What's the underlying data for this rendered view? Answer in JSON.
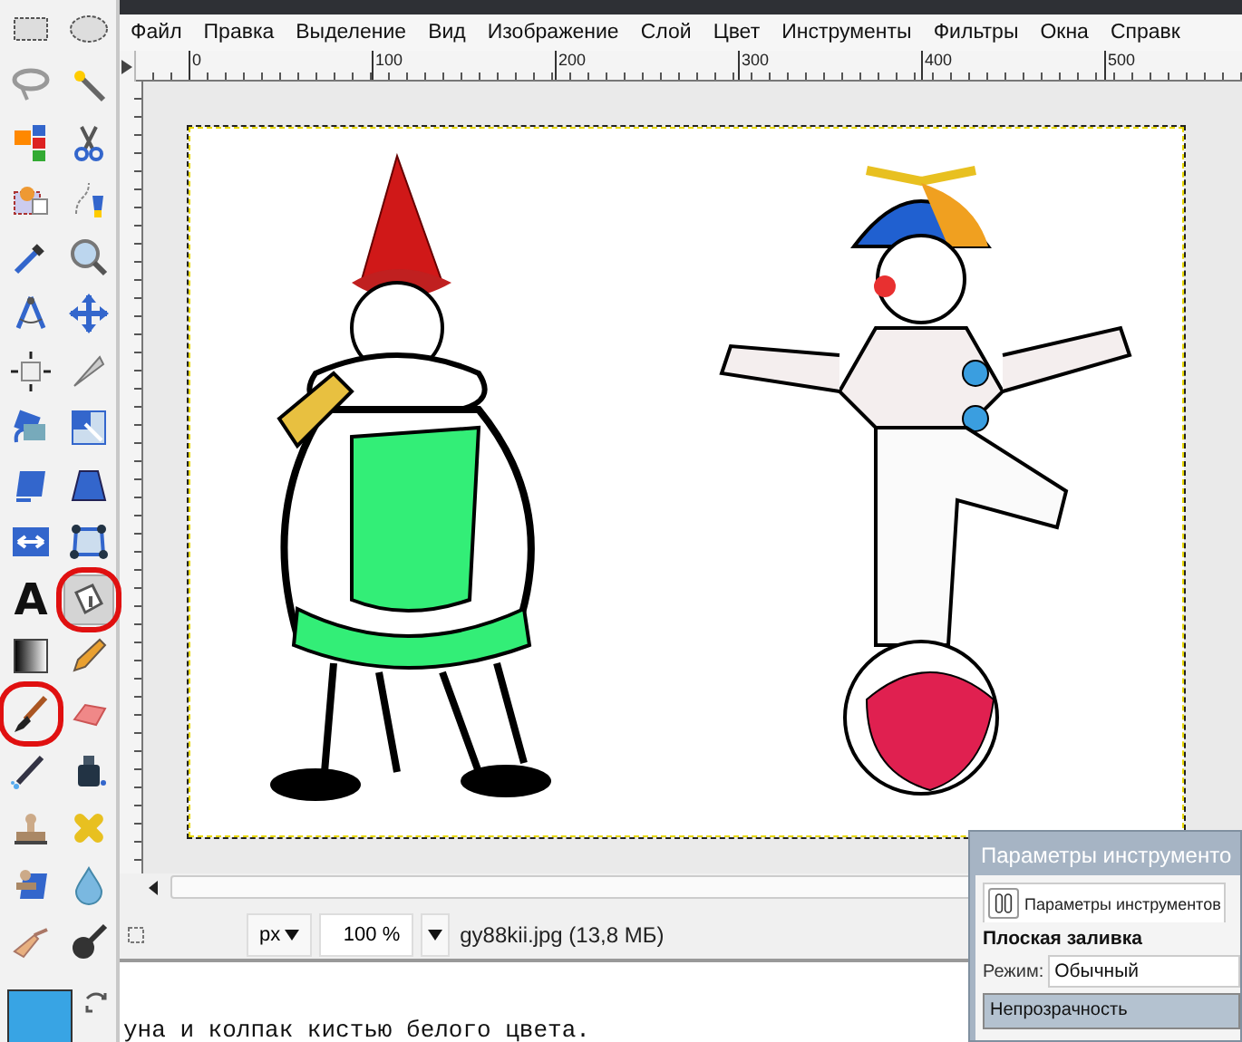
{
  "toolbox": {
    "tools": [
      {
        "selected": false,
        "circled": false
      },
      {
        "selected": false,
        "circled": false
      },
      {
        "selected": false,
        "circled": false
      },
      {
        "selected": false,
        "circled": false
      },
      {
        "selected": false,
        "circled": false
      },
      {
        "selected": false,
        "circled": false
      },
      {
        "selected": false,
        "circled": false
      },
      {
        "selected": false,
        "circled": false
      },
      {
        "selected": false,
        "circled": false
      },
      {
        "selected": false,
        "circled": false
      },
      {
        "selected": false,
        "circled": false
      },
      {
        "selected": false,
        "circled": false
      },
      {
        "selected": false,
        "circled": false
      },
      {
        "selected": false,
        "circled": false
      },
      {
        "selected": false,
        "circled": false
      },
      {
        "selected": false,
        "circled": false
      },
      {
        "selected": false,
        "circled": false
      },
      {
        "selected": false,
        "circled": false
      },
      {
        "selected": false,
        "circled": false
      },
      {
        "selected": false,
        "circled": false
      },
      {
        "selected": false,
        "circled": false,
        "glyph": "A"
      },
      {
        "selected": true,
        "circled": true
      },
      {
        "selected": false,
        "circled": false
      },
      {
        "selected": false,
        "circled": false
      },
      {
        "selected": false,
        "circled": true
      },
      {
        "selected": false,
        "circled": false
      },
      {
        "selected": false,
        "circled": false
      },
      {
        "selected": false,
        "circled": false
      },
      {
        "selected": false,
        "circled": false
      },
      {
        "selected": false,
        "circled": false
      },
      {
        "selected": false,
        "circled": false
      },
      {
        "selected": false,
        "circled": false
      },
      {
        "selected": false,
        "circled": false
      },
      {
        "selected": false,
        "circled": false
      }
    ]
  },
  "image_window": {
    "menu": [
      "Файл",
      "Правка",
      "Выделение",
      "Вид",
      "Изображение",
      "Слой",
      "Цвет",
      "Инструменты",
      "Фильтры",
      "Окна",
      "Справк"
    ],
    "ruler": {
      "labels": [
        "0",
        "100",
        "200",
        "300",
        "400",
        "500"
      ]
    },
    "status_bar": {
      "unit": "px",
      "zoom": "100 %",
      "file_info": "gy88kii.jpg (13,8 МБ)"
    }
  },
  "document_text": "уна и колпак кистью белого цвета.",
  "tool_options_dialog": {
    "title": "Параметры инструменто",
    "tab": {
      "label": "Параметры инструментов",
      "selected": true
    },
    "tool_name": "Плоская заливка",
    "mode": {
      "label": "Режим:",
      "value": "Обычный"
    },
    "opacity": {
      "label": "Непрозрачность",
      "level": 1
    }
  }
}
